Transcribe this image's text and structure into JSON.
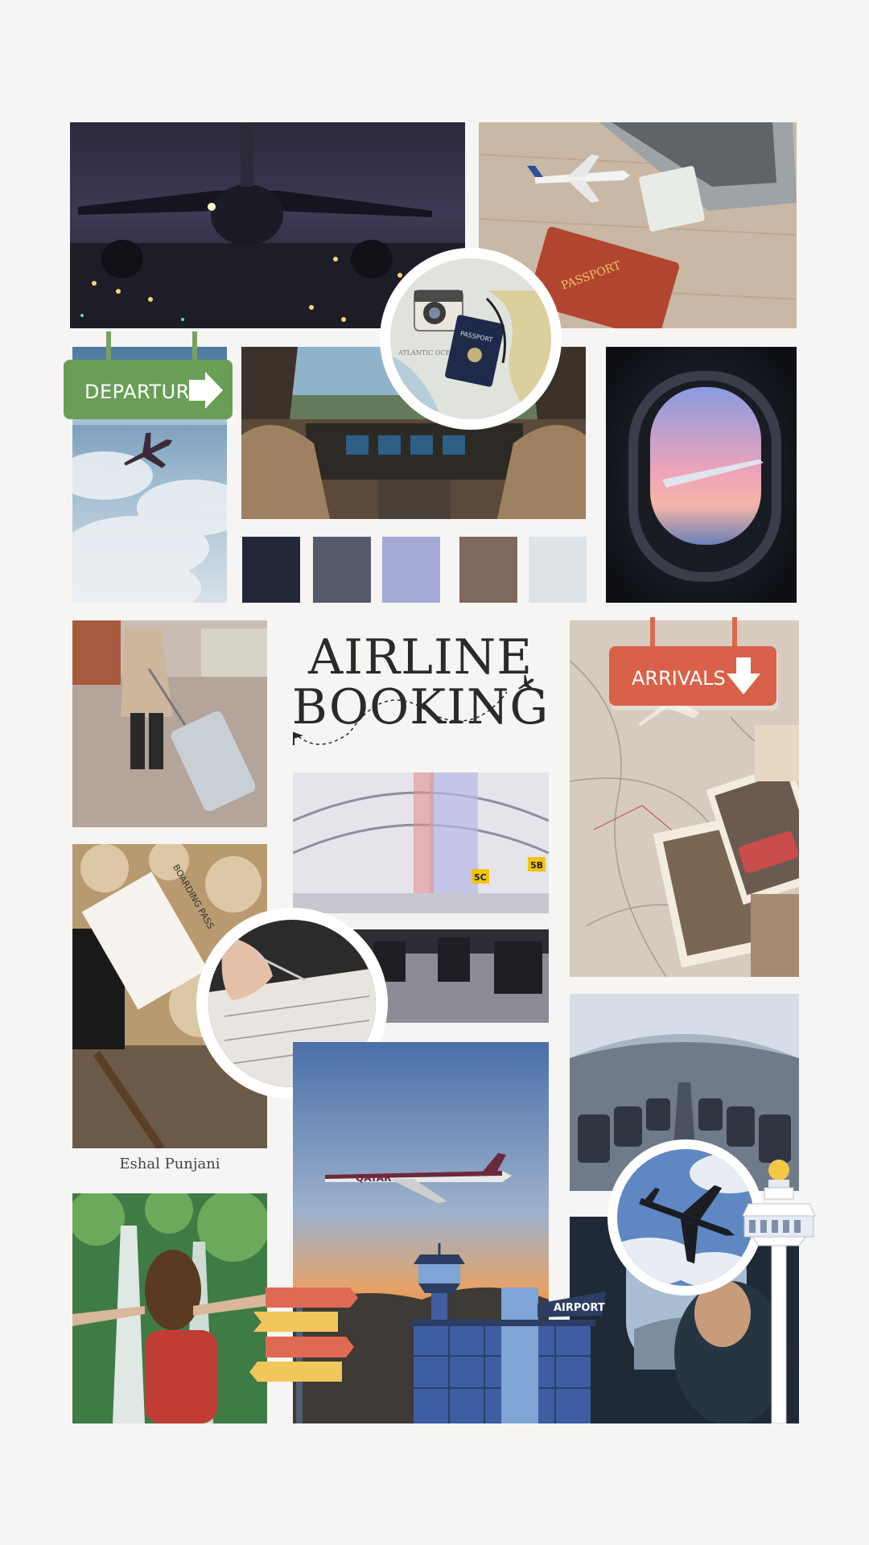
{
  "title": {
    "line1": "AIRLINE",
    "line2": "BOOKING"
  },
  "signs": {
    "departures": "DEPARTURES",
    "arrivals": "ARRIVALS",
    "airport": "AIRPORT"
  },
  "photo_text": {
    "passport_book": "PASSPORT",
    "passport_small": "PASSPORT",
    "map_label": "ATLANTIC OCEAN",
    "boarding_pass": "BOARDING PASS",
    "gate_5c": "5C",
    "gate_5b": "5B",
    "airline": "QATAR"
  },
  "credit": "Eshal Punjani",
  "palette": [
    "#22273a",
    "#545a6b",
    "#a5a9d5",
    "#7f695d",
    "#dee3e7"
  ],
  "icons": [
    "airplane-icon",
    "right-arrow-icon",
    "down-arrow-icon",
    "flag-icon",
    "airport-tower-icon"
  ]
}
